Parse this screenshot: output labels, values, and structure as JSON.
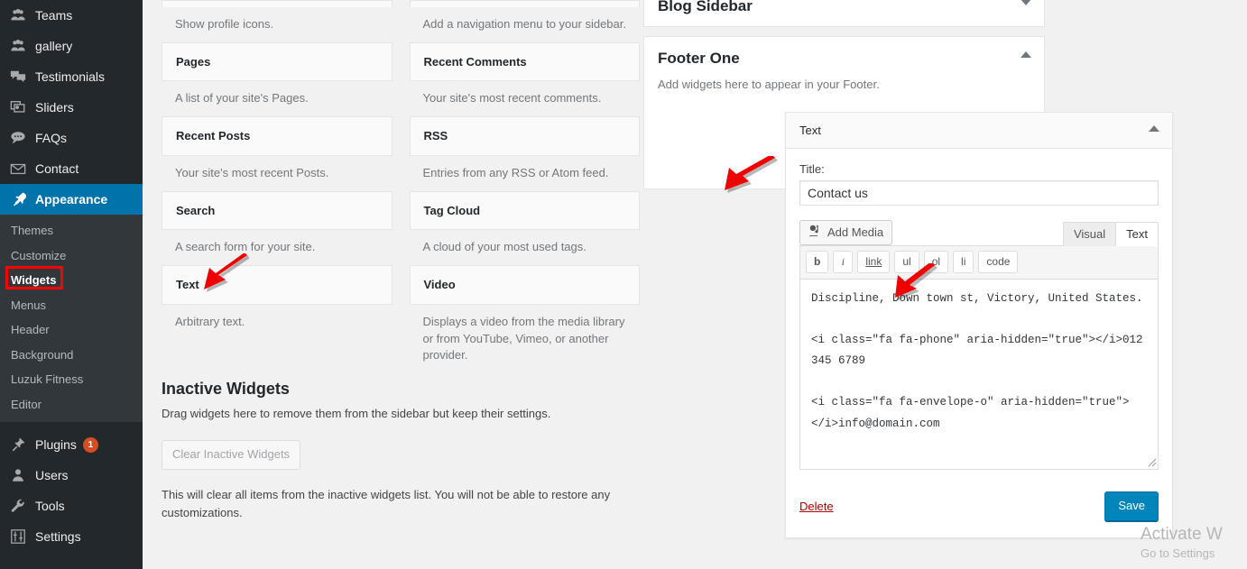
{
  "admin_menu": {
    "top_items": [
      {
        "label": "Teams",
        "icon": "groups-icon",
        "current": false
      },
      {
        "label": "gallery",
        "icon": "groups-icon",
        "current": false
      },
      {
        "label": "Testimonials",
        "icon": "testimonial-icon",
        "current": false
      },
      {
        "label": "Sliders",
        "icon": "images-alt-icon",
        "current": false
      },
      {
        "label": "FAQs",
        "icon": "format-chat-icon",
        "current": false
      },
      {
        "label": "Contact",
        "icon": "email-icon",
        "current": false
      },
      {
        "label": "Appearance",
        "icon": "admin-appearance-icon",
        "current": true
      }
    ],
    "submenu": [
      {
        "label": "Themes",
        "current": false
      },
      {
        "label": "Customize",
        "current": false
      },
      {
        "label": "Widgets",
        "current": true
      },
      {
        "label": "Menus",
        "current": false
      },
      {
        "label": "Header",
        "current": false
      },
      {
        "label": "Background",
        "current": false
      },
      {
        "label": "Luzuk Fitness",
        "current": false
      },
      {
        "label": "Editor",
        "current": false
      }
    ],
    "bottom_items": [
      {
        "label": "Plugins",
        "icon": "admin-plugins-icon",
        "badge": "1"
      },
      {
        "label": "Users",
        "icon": "admin-users-icon",
        "badge": ""
      },
      {
        "label": "Tools",
        "icon": "admin-tools-icon",
        "badge": ""
      },
      {
        "label": "Settings",
        "icon": "admin-settings-icon",
        "badge": ""
      }
    ],
    "colors": {
      "background": "#23282d",
      "submenu_background": "#32373c",
      "current": "#0073aa",
      "badge": "#d54e21"
    }
  },
  "available_widgets": {
    "column_left": [
      {
        "name": "",
        "description": "Show profile icons."
      },
      {
        "name": "Pages",
        "description": "A list of your site's Pages."
      },
      {
        "name": "Recent Posts",
        "description": "Your site's most recent Posts."
      },
      {
        "name": "Search",
        "description": "A search form for your site."
      },
      {
        "name": "Text",
        "description": "Arbitrary text."
      }
    ],
    "column_right": [
      {
        "name": "",
        "description": "Add a navigation menu to your sidebar."
      },
      {
        "name": "Recent Comments",
        "description": "Your site's most recent comments."
      },
      {
        "name": "RSS",
        "description": "Entries from any RSS or Atom feed."
      },
      {
        "name": "Tag Cloud",
        "description": "A cloud of your most used tags."
      },
      {
        "name": "Video",
        "description": "Displays a video from the media library or from YouTube, Vimeo, or another provider."
      }
    ]
  },
  "inactive_widgets": {
    "heading": "Inactive Widgets",
    "subtitle": "Drag widgets here to remove them from the sidebar but keep their settings.",
    "clear_button": "Clear Inactive Widgets",
    "note": "This will clear all items from the inactive widgets list. You will not be able to restore any customizations."
  },
  "sidebars": [
    {
      "title": "Blog Sidebar",
      "description": "",
      "toggle": "chevron-down-icon"
    },
    {
      "title": "Footer One",
      "description": "Add widgets here to appear in your Footer.",
      "toggle": "chevron-up-icon"
    }
  ],
  "text_widget": {
    "header_title": "Text",
    "toggle": "chevron-up-icon",
    "title_label": "Title:",
    "title_value": "Contact us",
    "add_media_label": "Add Media",
    "editor_tabs": [
      {
        "label": "Visual",
        "active": false
      },
      {
        "label": "Text",
        "active": true
      }
    ],
    "quicktags": [
      "b",
      "i",
      "link",
      "ul",
      "ol",
      "li",
      "code"
    ],
    "content": "Discipline, Down town st, Victory, United States.\n\n<i class=\"fa fa-phone\" aria-hidden=\"true\"></i>012 345 6789\n\n<i class=\"fa fa-envelope-o\" aria-hidden=\"true\"></i>info@domain.com",
    "delete_label": "Delete",
    "save_label": "Save",
    "save_color": "#0085ba",
    "delete_color": "#a00"
  },
  "annotations": {
    "arrow_color": "#ee0000",
    "arrows": [
      {
        "target": "text-widget-available",
        "direction": "down-left"
      },
      {
        "target": "title-input",
        "direction": "down-left"
      },
      {
        "target": "editor-textarea",
        "direction": "down-left"
      }
    ]
  },
  "watermark": {
    "line1": "Activate W",
    "line2": "Go to Settings"
  }
}
